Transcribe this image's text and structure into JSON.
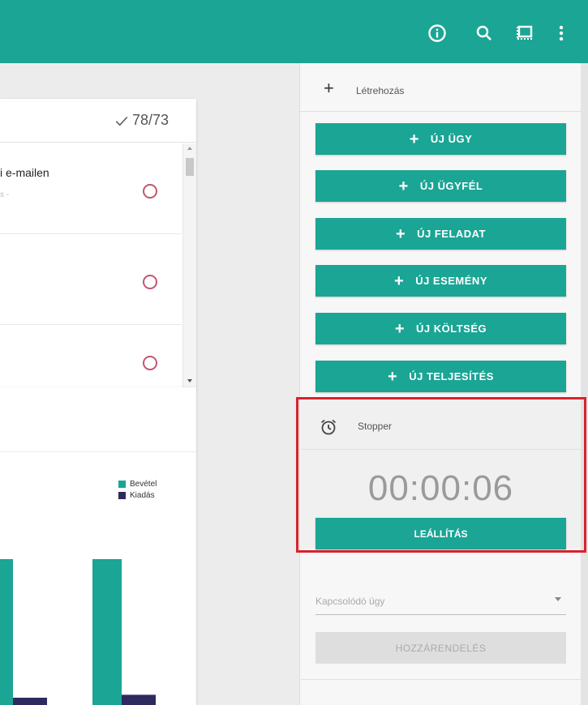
{
  "topbar": {
    "color": "#1aa595",
    "icons": [
      "info-icon",
      "search-icon",
      "screen-icon",
      "more-vert-icon"
    ]
  },
  "tasks": {
    "counter": "78/73",
    "items": [
      {
        "title": "i e-mailen",
        "sub": "s -"
      },
      {
        "title": "",
        "sub": ""
      },
      {
        "title": "",
        "sub": ""
      }
    ]
  },
  "chart_data": {
    "type": "bar",
    "categories": [
      "",
      ""
    ],
    "series": [
      {
        "name": "Bevétel",
        "color": "#1aa595",
        "values": [
          100,
          100
        ]
      },
      {
        "name": "Kiadás",
        "color": "#2e2a5e",
        "values": [
          5,
          7
        ]
      }
    ],
    "ylim": [
      0,
      100
    ]
  },
  "create": {
    "label": "Létrehozás",
    "buttons": [
      {
        "label": "ÚJ ÜGY"
      },
      {
        "label": "ÚJ ÜGYFÉL"
      },
      {
        "label": "ÚJ FELADAT"
      },
      {
        "label": "ÚJ ESEMÉNY"
      },
      {
        "label": "ÚJ KÖLTSÉG"
      },
      {
        "label": "ÚJ TELJESÍTÉS"
      }
    ]
  },
  "stopper": {
    "label": "Stopper",
    "time": "00:00:06",
    "stop_label": "LEÁLLÍTÁS"
  },
  "related": {
    "placeholder": "Kapcsolódó ügy",
    "assign_label": "HOZZÁRENDELÉS"
  }
}
